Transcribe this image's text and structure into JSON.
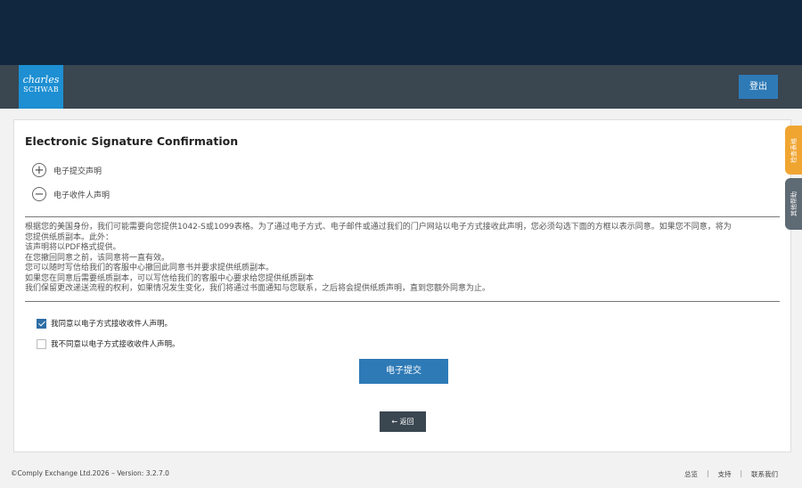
{
  "header": {
    "logo_line1": "charles",
    "logo_line2": "SCHWAB",
    "logout_label": "登出"
  },
  "main": {
    "title": "Electronic Signature Confirmation",
    "accordions": [
      {
        "icon": "+",
        "label": "电子提交声明"
      },
      {
        "icon": "−",
        "label": "电子收件人声明"
      }
    ],
    "statement_lines": [
      "根据您的美国身份，我们可能需要向您提供1042-S或1099表格。为了通过电子方式、电子邮件或通过我们的门户网站以电子方式接收此声明，您必须勾选下面的方框以表示同意。如果您不同意，将为",
      "您提供纸质副本。此外：",
      "该声明将以PDF格式提供。",
      "在您撤回同意之前，该同意将一直有效。",
      "您可以随时写信给我们的客服中心撤回此同意书并要求提供纸质副本。",
      "如果您在同意后需要纸质副本，可以写信给我们的客服中心要求给您提供纸质副本",
      "我们保留更改递送流程的权利，如果情况发生变化，我们将通过书面通知与您联系，之后将会提供纸质声明，直到您额外同意为止。"
    ],
    "options": [
      {
        "label": "我同意以电子方式接收收件人声明。",
        "checked": true
      },
      {
        "label": "我不同意以电子方式接收收件人声明。",
        "checked": false
      }
    ],
    "submit_label": "电子提交",
    "back_label": "返回"
  },
  "side_tabs": [
    {
      "label": "检查表格"
    },
    {
      "label": "其他帮助"
    }
  ],
  "footer": {
    "copyright": "©Comply Exchange Ltd.2026 – Version: 3.2.7.0",
    "links": [
      "总览",
      "支持",
      "联系我们"
    ]
  },
  "colors": {
    "top_band": "#11263f",
    "header": "#3a4650",
    "logo": "#1d8fd2",
    "primary_button": "#2e7ab6",
    "tab_orange": "#f0a531",
    "tab_gray": "#5e6a74"
  }
}
